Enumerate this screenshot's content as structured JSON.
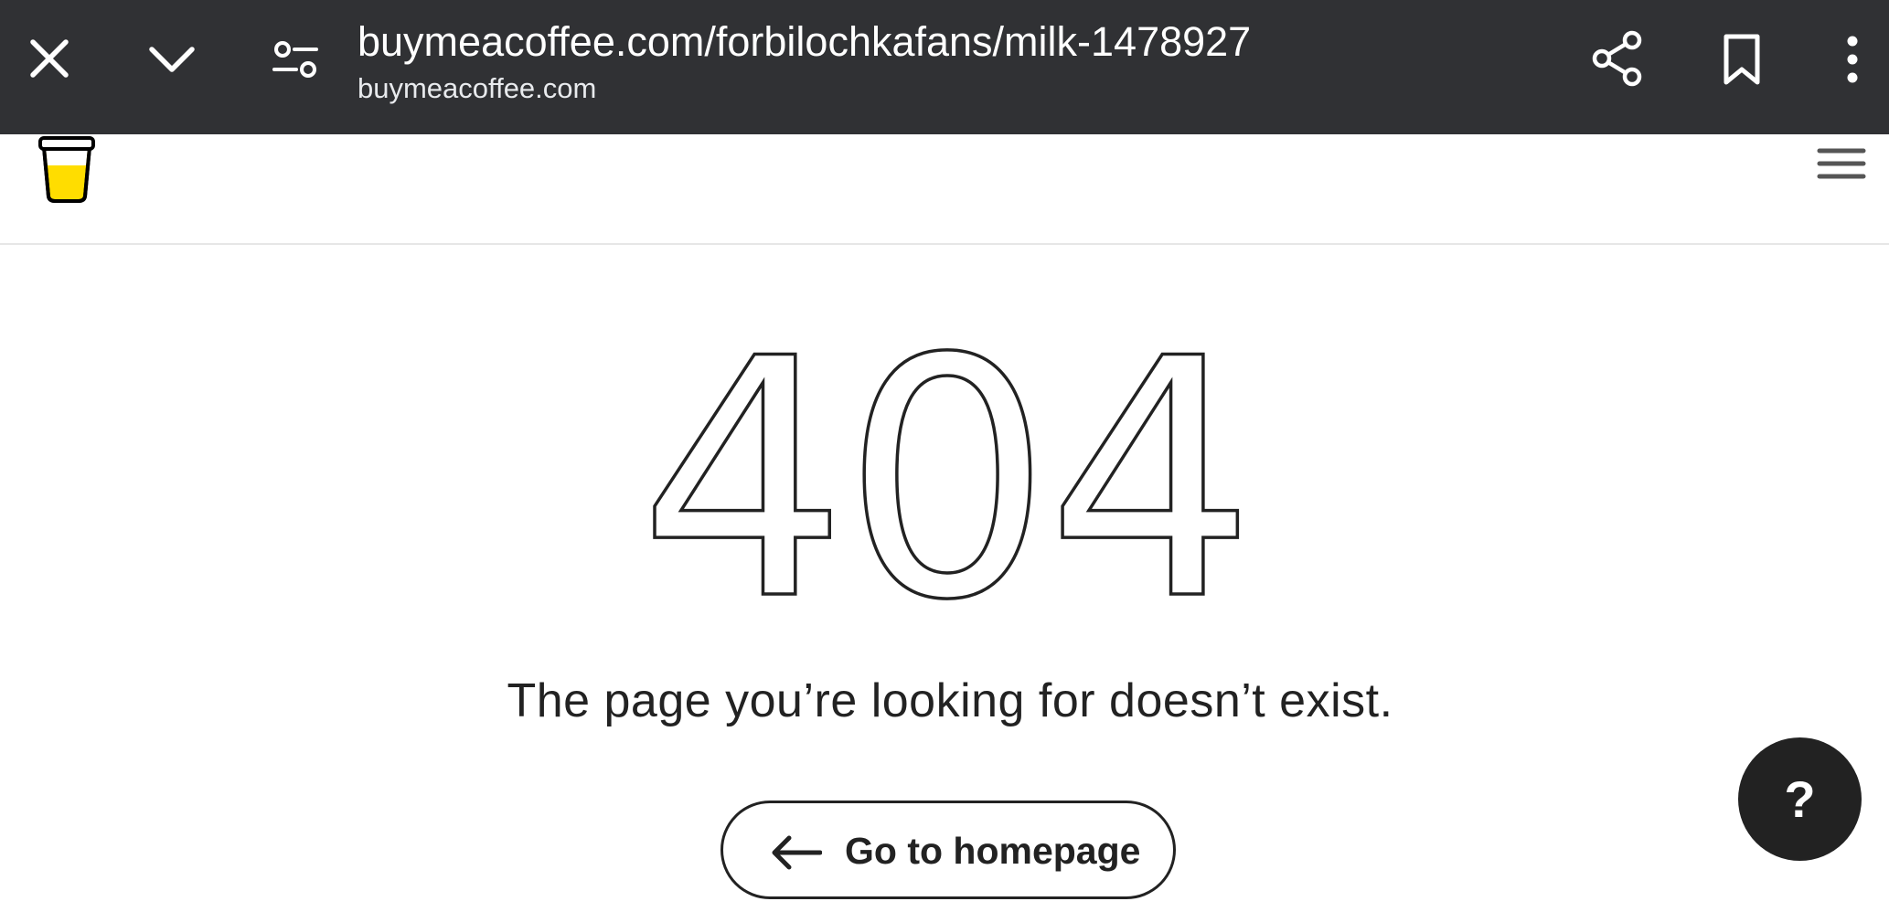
{
  "browser": {
    "url": "buymeacoffee.com/forbilochkafans/milk-1478927",
    "host": "buymeacoffee.com"
  },
  "page": {
    "error_code": "404",
    "message": "The page you’re looking for doesn’t exist.",
    "home_button_label": "Go to homepage",
    "help_label": "?"
  },
  "icons": {
    "close": "close-icon",
    "chevron": "chevron-down-icon",
    "tune": "page-info-icon",
    "share": "share-icon",
    "bookmark": "bookmark-icon",
    "more": "more-vert-icon",
    "logo": "coffee-cup-logo",
    "menu": "hamburger-menu-icon",
    "arrow": "arrow-left-icon"
  },
  "colors": {
    "browser_bar": "#303134",
    "logo_yellow": "#FFDD00",
    "text_dark": "#222222",
    "help_bg": "#222222"
  }
}
